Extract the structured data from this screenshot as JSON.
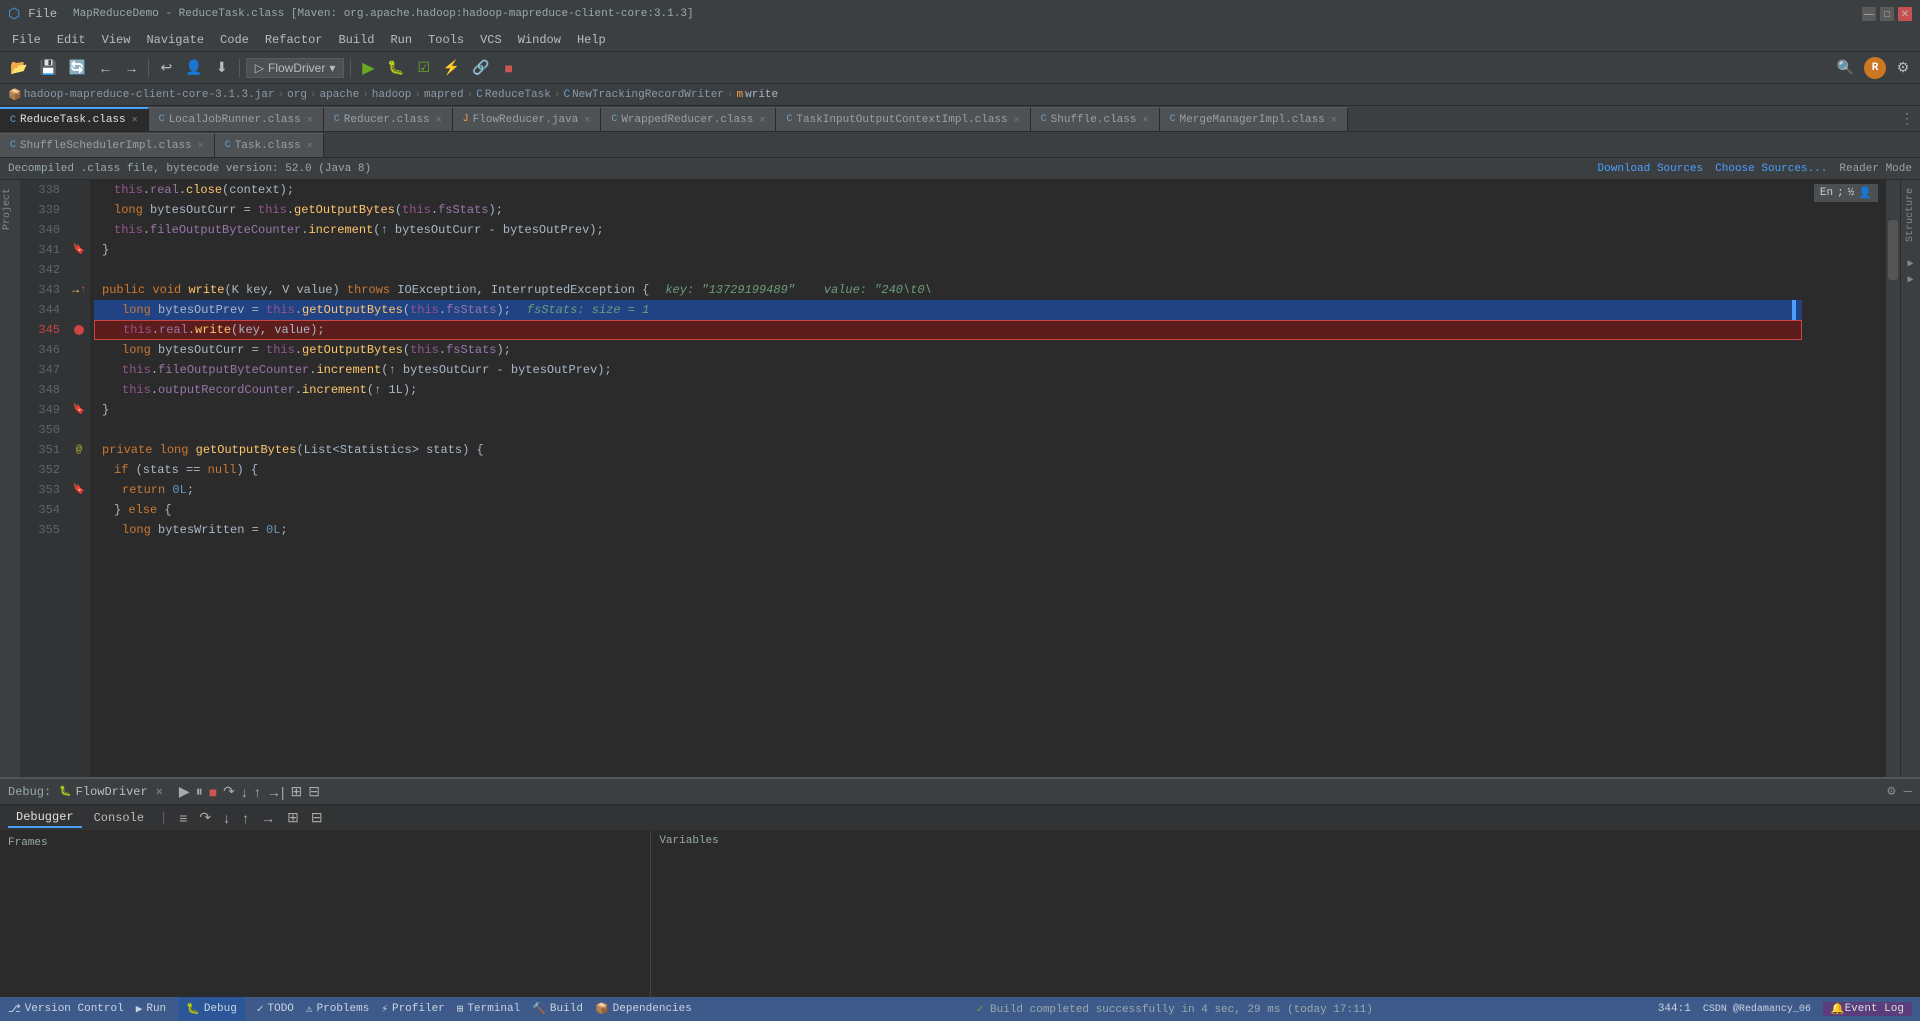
{
  "title_bar": {
    "title": "MapReduceDemo - ReduceTask.class [Maven: org.apache.hadoop:hadoop-mapreduce-client-core:3.1.3]",
    "minimize": "—",
    "maximize": "□",
    "close": "✕"
  },
  "menu": {
    "items": [
      "File",
      "Edit",
      "View",
      "Navigate",
      "Code",
      "Refactor",
      "Build",
      "Run",
      "Tools",
      "VCS",
      "Window",
      "Help"
    ]
  },
  "toolbar": {
    "flow_driver": "FlowDriver",
    "run_label": "▶",
    "stop_label": "■"
  },
  "breadcrumb": {
    "items": [
      "hadoop-mapreduce-client-core-3.1.3.jar",
      "org",
      "apache",
      "hadoop",
      "mapred",
      "ReduceTask",
      "NewTrackingRecordWriter",
      "write"
    ]
  },
  "tabs_row1": {
    "tabs": [
      {
        "label": "ReduceTask.class",
        "active": true,
        "icon": "class"
      },
      {
        "label": "LocalJobRunner.class",
        "active": false,
        "icon": "class"
      },
      {
        "label": "Reducer.class",
        "active": false,
        "icon": "class"
      },
      {
        "label": "FlowReducer.java",
        "active": false,
        "icon": "java"
      },
      {
        "label": "WrappedReducer.class",
        "active": false,
        "icon": "class"
      },
      {
        "label": "TaskInputOutputContextImpl.class",
        "active": false,
        "icon": "class"
      },
      {
        "label": "Shuffle.class",
        "active": false,
        "icon": "class"
      },
      {
        "label": "MergeManagerImpl.class",
        "active": false,
        "icon": "class"
      }
    ]
  },
  "tabs_row2": {
    "tabs": [
      {
        "label": "ShuffleSchedulerImpl.class",
        "active": false,
        "icon": "class"
      },
      {
        "label": "Task.class",
        "active": false,
        "icon": "class"
      }
    ]
  },
  "info_bar": {
    "message": "Decompiled .class file, bytecode version: 52.0 (Java 8)",
    "download_sources": "Download Sources",
    "choose_sources": "Choose Sources...",
    "reader_mode": "Reader Mode"
  },
  "code": {
    "lines": [
      {
        "num": "338",
        "content": "    this.real.close(context);",
        "gutter": ""
      },
      {
        "num": "339",
        "content": "    long bytesOutCurr = this.getOutputBytes(this.fsStats);",
        "gutter": ""
      },
      {
        "num": "340",
        "content": "    this.fileOutputByteCounter.increment(↑ bytesOutCurr - bytesOutPrev);",
        "gutter": ""
      },
      {
        "num": "341",
        "content": "  }",
        "gutter": "bookmark"
      },
      {
        "num": "342",
        "content": "",
        "gutter": ""
      },
      {
        "num": "343",
        "content": "  public void write(K key, V value) throws IOException, InterruptedException {",
        "gutter": "arrow",
        "debug": "key: \"13729199489\"    value: \"240\\t0\\"
      },
      {
        "num": "344",
        "content": "    long bytesOutPrev = this.getOutputBytes(this.fsStats);",
        "gutter": "",
        "debug": "fsStats:  size = 1",
        "selected": true
      },
      {
        "num": "345",
        "content": "    this.real.write(key, value);",
        "gutter": "breakpoint",
        "breakpoint": true
      },
      {
        "num": "346",
        "content": "    long bytesOutCurr = this.getOutputBytes(this.fsStats);",
        "gutter": ""
      },
      {
        "num": "347",
        "content": "    this.fileOutputByteCounter.increment(↑ bytesOutCurr - bytesOutPrev);",
        "gutter": ""
      },
      {
        "num": "348",
        "content": "    this.outputRecordCounter.increment(↑ 1L);",
        "gutter": ""
      },
      {
        "num": "349",
        "content": "  }",
        "gutter": "bookmark"
      },
      {
        "num": "350",
        "content": "",
        "gutter": ""
      },
      {
        "num": "351",
        "content": "  @",
        "gutter": "annotation",
        "extra": "private long getOutputBytes(List<Statistics> stats) {"
      },
      {
        "num": "352",
        "content": "    if (stats == null) {",
        "gutter": ""
      },
      {
        "num": "353",
        "content": "      return 0L;",
        "gutter": ""
      },
      {
        "num": "354",
        "content": "    } else {",
        "gutter": ""
      },
      {
        "num": "355",
        "content": "      long bytesWritten = 0L;",
        "gutter": ""
      }
    ]
  },
  "debug": {
    "label": "Debug:",
    "session_label": "FlowDriver",
    "tabs": [
      "Debugger",
      "Console"
    ],
    "active_tab": "Debugger"
  },
  "status_bar": {
    "version_control": "Version Control",
    "run": "Run",
    "debug": "Debug",
    "todo": "TODO",
    "problems": "Problems",
    "profiler": "Profiler",
    "terminal": "Terminal",
    "build": "Build",
    "dependencies": "Dependencies",
    "position": "344:1",
    "event_log": "Event Log",
    "build_status": "Build completed successfully in 4 sec, 29 ms (today 17:11)"
  },
  "right_panel": {
    "lang": "En",
    "separator": ";",
    "half_icon": "½"
  }
}
